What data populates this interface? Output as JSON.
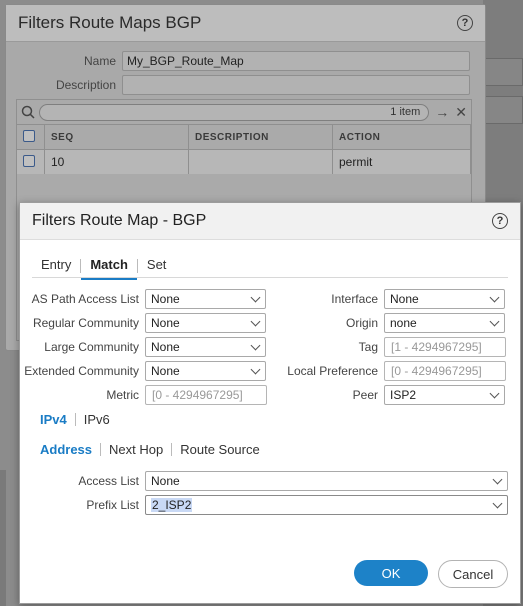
{
  "outer_dialog": {
    "title": "Filters Route Maps BGP",
    "name_label": "Name",
    "name_value": "My_BGP_Route_Map",
    "description_label": "Description",
    "description_value": "",
    "grid": {
      "item_count": "1 item",
      "columns": [
        "SEQ",
        "DESCRIPTION",
        "ACTION"
      ],
      "rows": [
        {
          "seq": "10",
          "description": "",
          "action": "permit"
        }
      ]
    }
  },
  "modal": {
    "title": "Filters Route Map - BGP",
    "tabs": [
      "Entry",
      "Match",
      "Set"
    ],
    "active_tab": "Match",
    "left_fields": {
      "as_path_label": "AS Path Access List",
      "as_path_value": "None",
      "regular_comm_label": "Regular Community",
      "regular_comm_value": "None",
      "large_comm_label": "Large Community",
      "large_comm_value": "None",
      "extended_comm_label": "Extended Community",
      "extended_comm_value": "None",
      "metric_label": "Metric",
      "metric_placeholder": "[0 - 4294967295]"
    },
    "right_fields": {
      "interface_label": "Interface",
      "interface_value": "None",
      "origin_label": "Origin",
      "origin_value": "none",
      "tag_label": "Tag",
      "tag_placeholder": "[1 - 4294967295]",
      "local_pref_label": "Local Preference",
      "local_pref_placeholder": "[0 - 4294967295]",
      "peer_label": "Peer",
      "peer_value": "ISP2"
    },
    "ip_tabs": [
      "IPv4",
      "IPv6"
    ],
    "address_tabs": [
      "Address",
      "Next Hop",
      "Route Source"
    ],
    "access_list_label": "Access List",
    "access_list_value": "None",
    "prefix_list_label": "Prefix List",
    "prefix_list_value": "2_ISP2",
    "ok_label": "OK",
    "cancel_label": "Cancel"
  },
  "icons": [
    "help-icon",
    "search-icon",
    "arrow-right-icon",
    "clear-icon",
    "chevron-down-icon"
  ],
  "colors": {
    "accent": "#1a7cc5",
    "ok_button": "#1d82c8"
  }
}
